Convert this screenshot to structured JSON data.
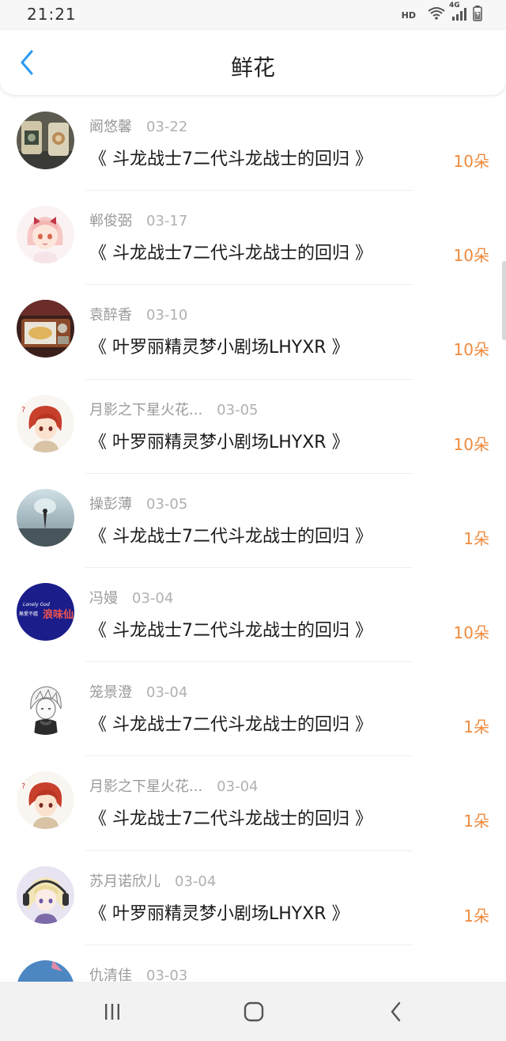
{
  "status_bar": {
    "time": "21:21",
    "hd_label": "HD",
    "network_label": "4G",
    "icons": [
      "wifi-icon",
      "cellular-signal-icon",
      "battery-icon"
    ]
  },
  "header": {
    "title": "鲜花",
    "back_icon": "chevron-left-icon",
    "accent_color": "#2b9af3"
  },
  "gift_color": "#f08a3c",
  "records": [
    {
      "user": "阚悠馨",
      "date": "03-22",
      "work": "《 斗龙战士7二代斗龙战士的回归 》",
      "amount": "10朵"
    },
    {
      "user": "郸俊弼",
      "date": "03-17",
      "work": "《 斗龙战士7二代斗龙战士的回归 》",
      "amount": "10朵"
    },
    {
      "user": "袁醉香",
      "date": "03-10",
      "work": "《 叶罗丽精灵梦小剧场LHYXR 》",
      "amount": "10朵"
    },
    {
      "user": "月影之下星火花...",
      "date": "03-05",
      "work": "《 叶罗丽精灵梦小剧场LHYXR 》",
      "amount": "10朵"
    },
    {
      "user": "操彭薄",
      "date": "03-05",
      "work": "《 斗龙战士7二代斗龙战士的回归 》",
      "amount": "1朵"
    },
    {
      "user": "冯嫚",
      "date": "03-04",
      "work": "《 斗龙战士7二代斗龙战士的回归 》",
      "amount": "10朵"
    },
    {
      "user": "笼景澄",
      "date": "03-04",
      "work": "《 斗龙战士7二代斗龙战士的回归 》",
      "amount": "1朵"
    },
    {
      "user": "月影之下星火花...",
      "date": "03-04",
      "work": "《 斗龙战士7二代斗龙战士的回归 》",
      "amount": "1朵"
    },
    {
      "user": "苏月诺欣儿",
      "date": "03-04",
      "work": "《 叶罗丽精灵梦小剧场LHYXR 》",
      "amount": "1朵"
    },
    {
      "user": "仇清佳",
      "date": "03-03",
      "work": "",
      "amount": ""
    }
  ],
  "avatar_texts": {
    "row6_small": "Lonely God",
    "row6_main": "浪味仙",
    "row6_side": "無愛不嬉"
  },
  "nav_bar": {
    "icons": [
      "recent-apps-icon",
      "home-icon",
      "back-icon"
    ]
  }
}
